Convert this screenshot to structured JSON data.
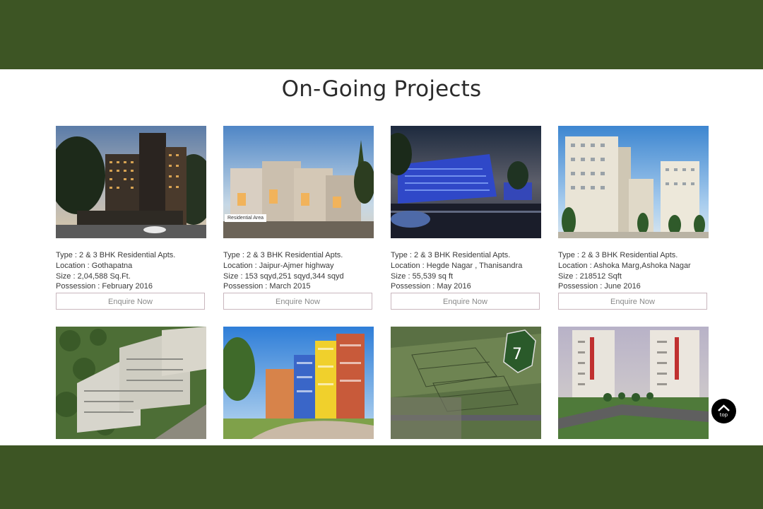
{
  "section": {
    "title": "On-Going Projects"
  },
  "projects": [
    {
      "type": "Type : 2 & 3 BHK Residential Apts.",
      "location": "Location : Gothapatna",
      "size": "Size : 2,04,588 Sq.Ft.",
      "possession": "Possession : February 2016",
      "enquire_label": "Enquire Now"
    },
    {
      "type": "Type : 2 & 3 BHK Residential Apts.",
      "location": "Location : Jaipur-Ajmer highway",
      "size": "Size : 153 sqyd,251 sqyd,344 sqyd",
      "possession": "Possession : March 2015",
      "enquire_label": "Enquire Now",
      "image_tag": "Residential Area"
    },
    {
      "type": "Type : 2 & 3 BHK Residential Apts.",
      "location": "Location : Hegde Nagar , Thanisandra",
      "size": "Size : 55,539 sq ft",
      "possession": "Possession : May 2016",
      "enquire_label": "Enquire Now"
    },
    {
      "type": "Type : 2 & 3 BHK Residential Apts.",
      "location": "Location : Ashoka Marg,Ashoka Nagar",
      "size": "Size : 218512 Sqft",
      "possession": "Possession : June 2016",
      "enquire_label": "Enquire Now"
    }
  ],
  "scroll_top": {
    "label": "top",
    "icon": "chevron-up-icon"
  },
  "colors": {
    "band": "#3d5524",
    "button_border": "#c9b7be"
  }
}
